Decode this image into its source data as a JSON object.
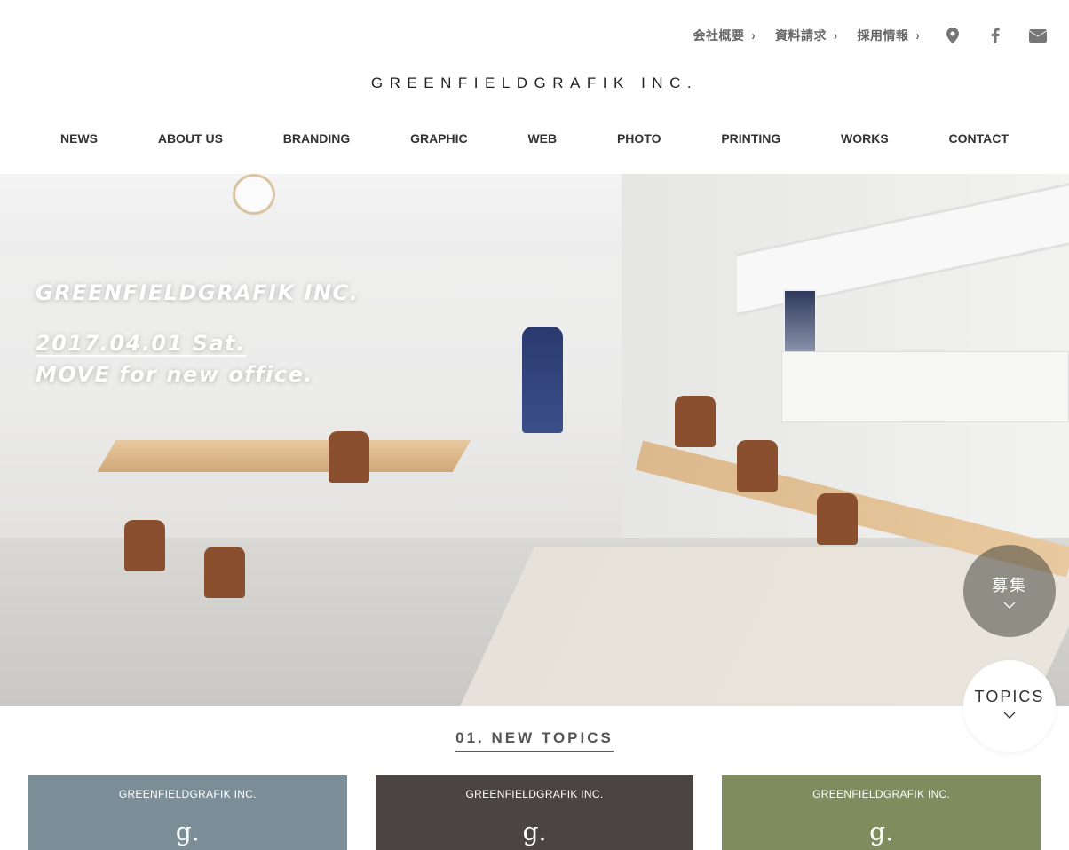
{
  "utility": {
    "links": [
      {
        "label": "会社概要"
      },
      {
        "label": "資料請求"
      },
      {
        "label": "採用情報"
      }
    ],
    "icons": [
      "map-pin-icon",
      "facebook-icon",
      "mail-icon"
    ]
  },
  "logo": {
    "text": "GREENFIELDGRAFIK INC."
  },
  "nav": {
    "items": [
      "NEWS",
      "ABOUT US",
      "BRANDING",
      "GRAPHIC",
      "WEB",
      "PHOTO",
      "PRINTING",
      "WORKS",
      "CONTACT"
    ]
  },
  "hero": {
    "title": "GREENFIELDGRAFIK INC.",
    "date": "2017.04.01 Sat.",
    "subtitle": "MOVE for new office."
  },
  "floating": {
    "recruit_label": "募集",
    "topics_label": "TOPICS"
  },
  "section": {
    "title": "01. NEW TOPICS"
  },
  "cards": [
    {
      "brand": "GREENFIELDGRAFIK INC.",
      "mark": "g.",
      "color": "#7b8d97"
    },
    {
      "brand": "GREENFIELDGRAFIK INC.",
      "mark": "g.",
      "color": "#4a4442"
    },
    {
      "brand": "GREENFIELDGRAFIK INC.",
      "mark": "g.",
      "color": "#7e8c5e"
    }
  ]
}
